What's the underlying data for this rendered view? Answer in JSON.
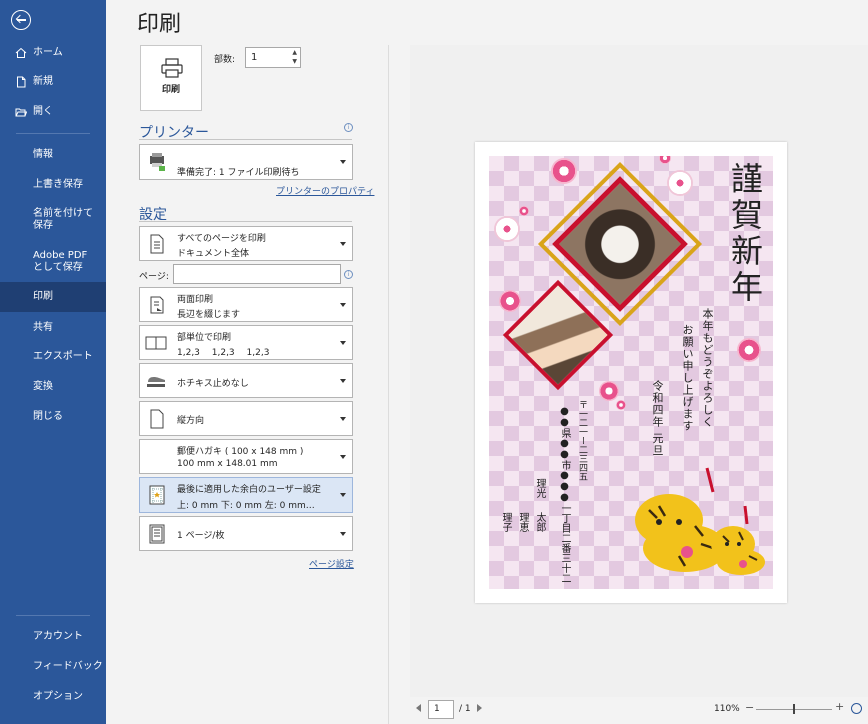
{
  "nav": {
    "items": [
      {
        "label": "ホーム",
        "icon": "home-icon"
      },
      {
        "label": "新規",
        "icon": "new-document-icon"
      },
      {
        "label": "開く",
        "icon": "folder-open-icon"
      },
      {
        "label": "情報"
      },
      {
        "label": "上書き保存"
      },
      {
        "label": "名前を付けて保存"
      },
      {
        "label": "Adobe PDF として保存"
      },
      {
        "label": "印刷",
        "active": true
      },
      {
        "label": "共有"
      },
      {
        "label": "エクスポート"
      },
      {
        "label": "変換"
      },
      {
        "label": "閉じる"
      }
    ],
    "bottom": [
      {
        "label": "アカウント"
      },
      {
        "label": "フィードバック"
      },
      {
        "label": "オプション"
      }
    ]
  },
  "page_title": "印刷",
  "print_button": {
    "label": "印刷",
    "icon": "printer-icon"
  },
  "copies": {
    "label": "部数:",
    "value": "1"
  },
  "printer": {
    "section": "プリンター",
    "name": "",
    "status": "準備完了: 1 ファイル印刷待ち",
    "properties_link": "プリンターのプロパティ",
    "icon": "printer-device-icon"
  },
  "settings": {
    "section": "設定",
    "print_range": {
      "line1": "すべてのページを印刷",
      "line2": "ドキュメント全体"
    },
    "pages_label": "ページ:",
    "duplex": {
      "line1": "両面印刷",
      "line2": "長辺を綴じます"
    },
    "collate": {
      "line1": "部単位で印刷",
      "line2": "1,2,3　 1,2,3　 1,2,3"
    },
    "staple": {
      "line1": "ホチキス止めなし"
    },
    "orientation": {
      "line1": "縦方向"
    },
    "paper": {
      "line1": "郵便ハガキ ( 100 x 148 mm )",
      "line2": "100 mm x 148.01 mm"
    },
    "margins": {
      "line1": "最後に適用した余白のユーザー設定",
      "line2": "上: 0 mm 下: 0 mm 左: 0 mm…"
    },
    "per_sheet": {
      "line1": "1 ページ/枚"
    },
    "page_setup_link": "ページ設定"
  },
  "card": {
    "greeting": "謹賀新年",
    "message1": "本年もどうぞよろしく",
    "message2": "お願い申し上げます",
    "date": "令和四年 元旦",
    "postal": "〒一二一ー二三四五",
    "address": "●●県●●市●●●一丁目二番三十二",
    "name1a": "理光",
    "name1b": "太郎",
    "name2a": "理子",
    "name2b": "理恵",
    "colors": {
      "pink": "#e8528c",
      "red": "#c8102e",
      "gold": "#d9a41a"
    }
  },
  "pager": {
    "current": "1",
    "total": "/ 1"
  },
  "zoom": {
    "value": "110%",
    "minus": "−",
    "plus": "+"
  }
}
